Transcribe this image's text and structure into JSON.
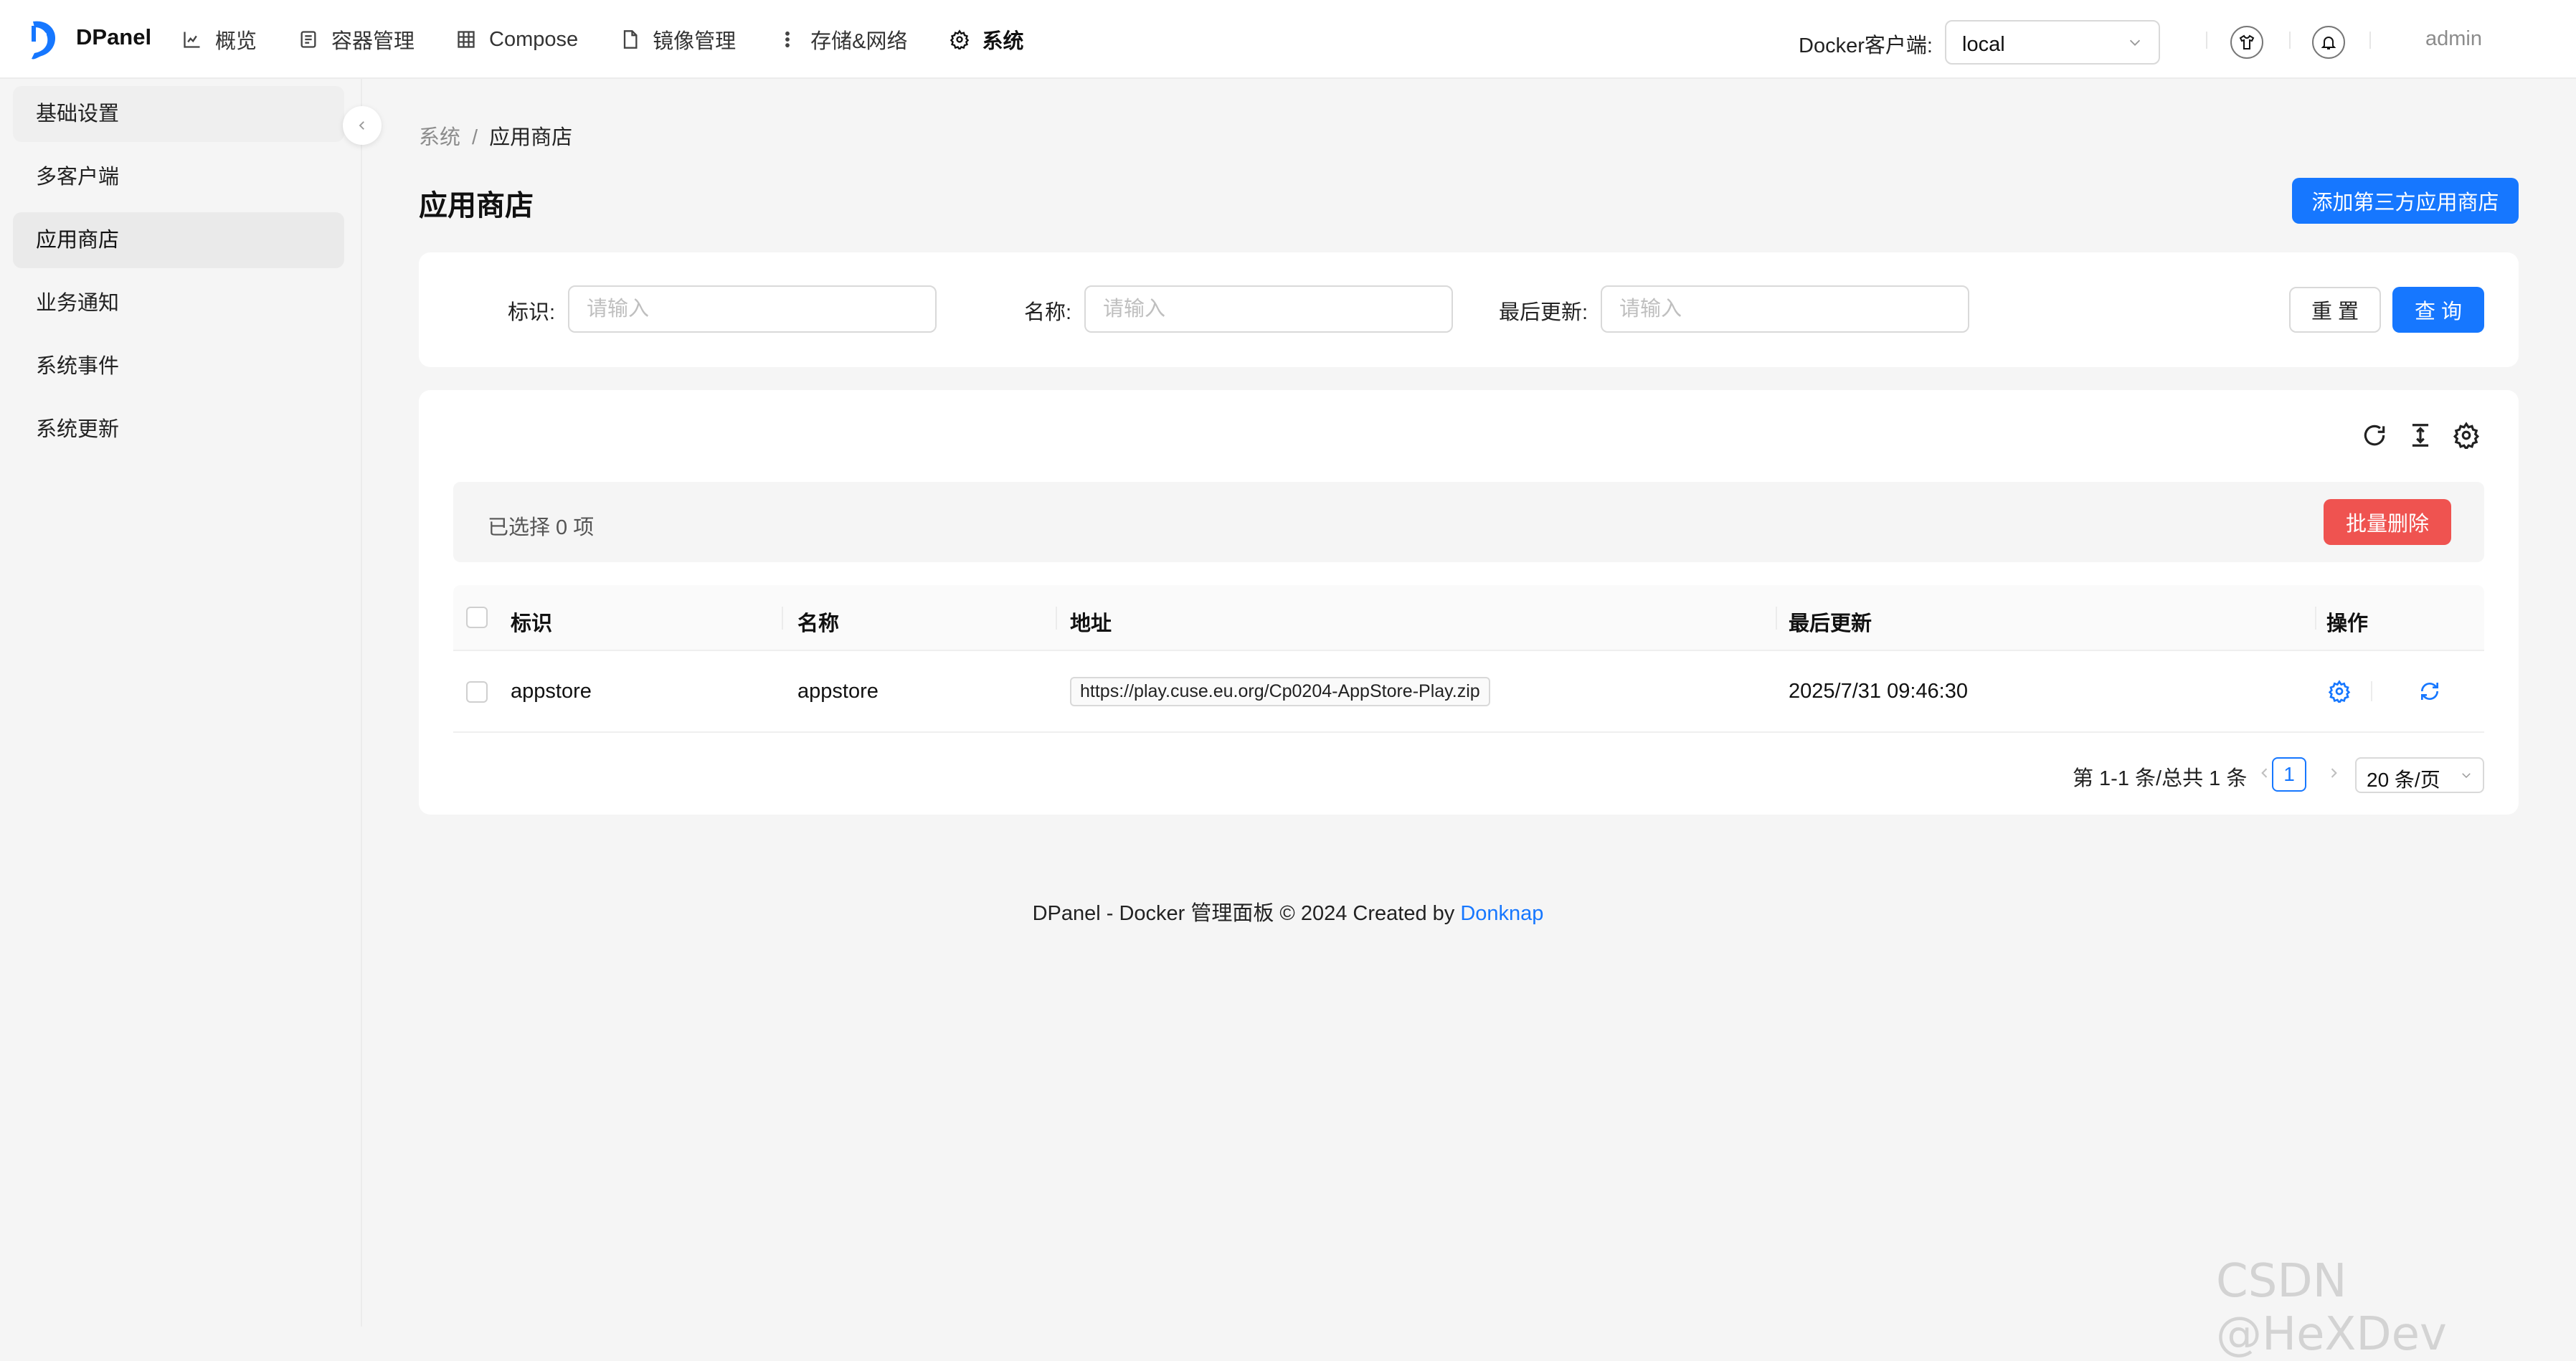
{
  "header": {
    "brand": "DPanel",
    "nav": [
      {
        "label": "概览",
        "icon": "chart-icon"
      },
      {
        "label": "容器管理",
        "icon": "container-icon"
      },
      {
        "label": "Compose",
        "icon": "compose-icon"
      },
      {
        "label": "镜像管理",
        "icon": "file-icon"
      },
      {
        "label": "存储&网络",
        "icon": "more-vertical-icon"
      },
      {
        "label": "系统",
        "icon": "gear-icon",
        "active": true
      }
    ],
    "client_label": "Docker客户端:",
    "client_value": "local",
    "user": "admin"
  },
  "sidebar": {
    "items": [
      {
        "label": "基础设置"
      },
      {
        "label": "多客户端"
      },
      {
        "label": "应用商店",
        "active": true
      },
      {
        "label": "业务通知"
      },
      {
        "label": "系统事件"
      },
      {
        "label": "系统更新"
      }
    ]
  },
  "main": {
    "breadcrumb": [
      "系统",
      "应用商店"
    ],
    "breadcrumb_sep": "/",
    "title": "应用商店",
    "add_button": "添加第三方应用商店",
    "filters": [
      {
        "label": "标识:",
        "placeholder": "请输入"
      },
      {
        "label": "名称:",
        "placeholder": "请输入"
      },
      {
        "label": "最后更新:",
        "placeholder": "请输入"
      }
    ],
    "reset_button": "重 置",
    "query_button": "查 询",
    "selection_text": "已选择  0  项",
    "batch_delete_button": "批量删除",
    "table": {
      "columns": [
        "标识",
        "名称",
        "地址",
        "最后更新",
        "操作"
      ],
      "rows": [
        {
          "id": "appstore",
          "name": "appstore",
          "url": "https://play.cuse.eu.org/Cp0204-AppStore-Play.zip",
          "updated": "2025/7/31 09:46:30"
        }
      ]
    },
    "pagination": {
      "total_text": "第 1-1 条/总共 1 条",
      "current_page": "1",
      "page_size": "20 条/页"
    }
  },
  "footer": {
    "text": "DPanel - Docker 管理面板 © 2024 Created by ",
    "link": "Donknap"
  },
  "watermark": "CSDN @HeXDev",
  "colors": {
    "primary": "#1677ff",
    "danger": "#ef5350",
    "background": "#f5f5f5"
  }
}
